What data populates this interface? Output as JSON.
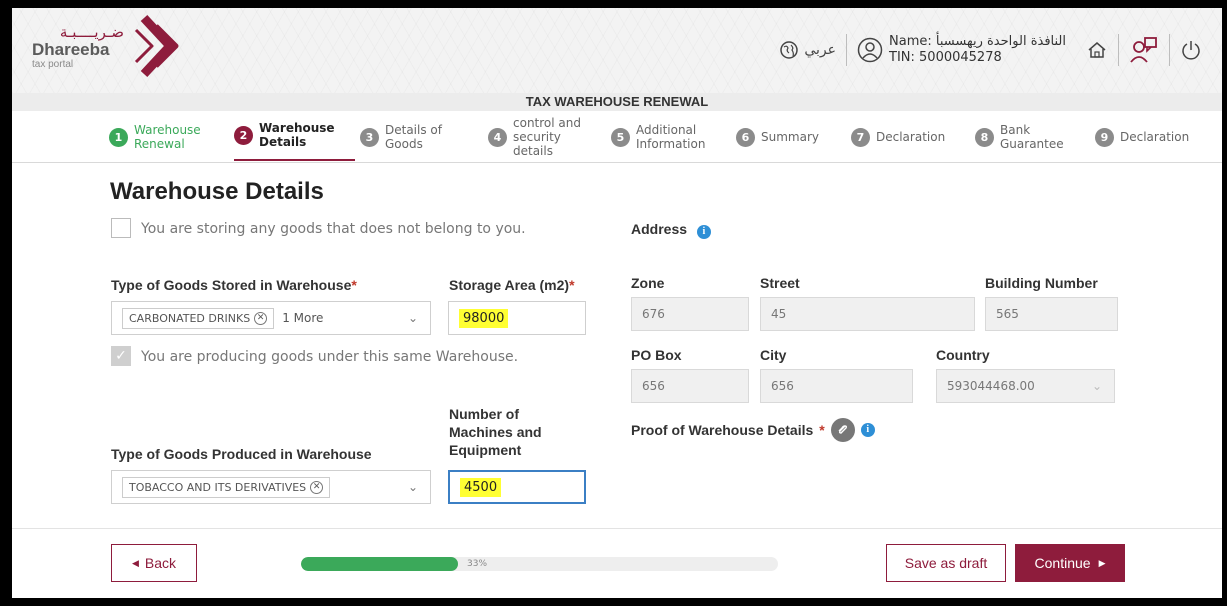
{
  "header": {
    "brand_ar": "ضـريــــبـة",
    "brand_en": "Dhareeba",
    "brand_sub": "tax portal",
    "language_label": "عربي",
    "user_name": "Name: النافذة الواحدة ريهسسبأ",
    "user_tin": "TIN: 5000045278"
  },
  "page": {
    "process_title": "TAX WAREHOUSE RENEWAL",
    "heading": "Warehouse Details"
  },
  "steps": [
    {
      "num": "1",
      "label": "Warehouse Renewal",
      "state": "done"
    },
    {
      "num": "2",
      "label": "Warehouse Details",
      "state": "active"
    },
    {
      "num": "3",
      "label": "Details of Goods",
      "state": "pending"
    },
    {
      "num": "4",
      "label": "control and security details",
      "state": "pending"
    },
    {
      "num": "5",
      "label": "Additional Information",
      "state": "pending"
    },
    {
      "num": "6",
      "label": "Summary",
      "state": "pending"
    },
    {
      "num": "7",
      "label": "Declaration",
      "state": "pending"
    },
    {
      "num": "8",
      "label": "Bank Guarantee",
      "state": "pending"
    },
    {
      "num": "9",
      "label": "Declaration",
      "state": "pending"
    }
  ],
  "form": {
    "storing_others_goods_label": "You are storing any goods that does not belong to you.",
    "storing_others_goods_checked": false,
    "goods_stored_label": "Type of Goods Stored in Warehouse",
    "goods_stored_tag": "CARBONATED DRINKS",
    "goods_stored_more": "1 More",
    "storage_area_label": "Storage Area (m2)",
    "storage_area_value": "98000",
    "producing_goods_label": "You are producing goods under this same Warehouse.",
    "producing_goods_checked": true,
    "goods_produced_label": "Type of Goods Produced in Warehouse",
    "goods_produced_tag": "TOBACCO AND ITS DERIVATIVES",
    "machines_label": "Number of Machines and Equipment",
    "machines_value": "4500",
    "required_mark": "*"
  },
  "address": {
    "title": "Address",
    "zone_label": "Zone",
    "zone_value": "676",
    "street_label": "Street",
    "street_value": "45",
    "building_label": "Building Number",
    "building_value": "565",
    "pobox_label": "PO Box",
    "pobox_value": "656",
    "city_label": "City",
    "city_value": "656",
    "country_label": "Country",
    "country_value": "593044468.00",
    "proof_label": "Proof of Warehouse Details"
  },
  "footer": {
    "back_label": "Back",
    "draft_label": "Save as draft",
    "continue_label": "Continue",
    "progress_percent": 33,
    "progress_text": "33%"
  },
  "colors": {
    "brand": "#8e1c3c",
    "success": "#3ba95a",
    "info": "#2e8fd6",
    "highlight": "#ffff33"
  }
}
